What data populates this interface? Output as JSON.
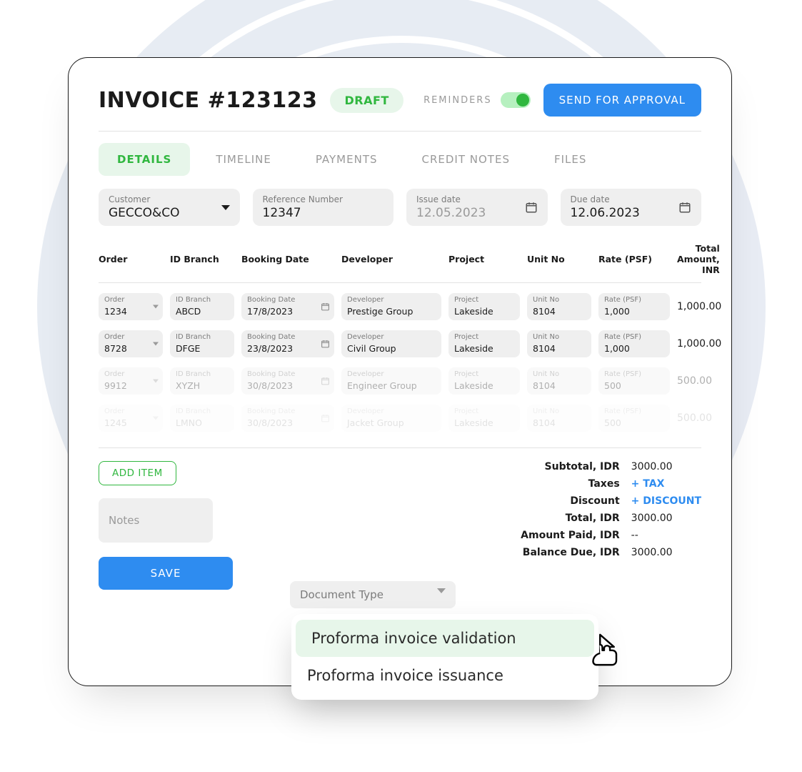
{
  "header": {
    "title": "INVOICE #123123",
    "status": "DRAFT",
    "reminders_label": "REMINDERS",
    "reminders_on": true,
    "action_button": "SEND FOR APPROVAL"
  },
  "tabs": [
    "DETAILS",
    "TIMELINE",
    "PAYMENTS",
    "CREDIT NOTES",
    "FILES"
  ],
  "active_tab": 0,
  "fields": {
    "customer": {
      "label": "Customer",
      "value": "GECCO&CO"
    },
    "reference": {
      "label": "Reference Number",
      "value": "12347"
    },
    "issue_date": {
      "label": "Issue date",
      "value": "12.05.2023"
    },
    "due_date": {
      "label": "Due date",
      "value": "12.06.2023"
    }
  },
  "columns": [
    "Order",
    "ID Branch",
    "Booking Date",
    "Developer",
    "Project",
    "Unit No",
    "Rate (PSF)",
    "Total Amount, INR"
  ],
  "rows": [
    {
      "order": "1234",
      "branch": "ABCD",
      "date": "17/8/2023",
      "dev": "Prestige Group",
      "project": "Lakeside",
      "unit": "8104",
      "rate": "1,000",
      "amount": "1,000.00",
      "fade": ""
    },
    {
      "order": "8728",
      "branch": "DFGE",
      "date": "23/8/2023",
      "dev": "Civil Group",
      "project": "Lakeside",
      "unit": "8104",
      "rate": "1,000",
      "amount": "1,000.00",
      "fade": ""
    },
    {
      "order": "9912",
      "branch": "XYZH",
      "date": "30/8/2023",
      "dev": "Engineer Group",
      "project": "Lakeside",
      "unit": "8104",
      "rate": "500",
      "amount": "500.00",
      "fade": "faded"
    },
    {
      "order": "1245",
      "branch": "LMNO",
      "date": "30/8/2023",
      "dev": "Jacket Group",
      "project": "Lakeside",
      "unit": "8104",
      "rate": "500",
      "amount": "500.00",
      "fade": "faded2"
    }
  ],
  "row_labels": {
    "order": "Order",
    "branch": "ID Branch",
    "date": "Booking Date",
    "dev": "Developer",
    "project": "Project",
    "unit": "Unit No",
    "rate": "Rate (PSF)"
  },
  "add_item": "ADD ITEM",
  "notes_placeholder": "Notes",
  "doc_type_label": "Document Type",
  "save": "SAVE",
  "totals": [
    {
      "label": "Subtotal, IDR",
      "value": "3000.00"
    },
    {
      "label": "Taxes",
      "value": "+ TAX",
      "link": true
    },
    {
      "label": "Discount",
      "value": "+ DISCOUNT",
      "link": true
    },
    {
      "label": "Total, IDR",
      "value": "3000.00"
    },
    {
      "label": "Amount Paid, IDR",
      "value": "--"
    },
    {
      "label": "Balance Due, IDR",
      "value": "3000.00"
    }
  ],
  "popover": {
    "options": [
      "Proforma invoice validation",
      "Proforma invoice issuance"
    ],
    "highlight": 0
  }
}
